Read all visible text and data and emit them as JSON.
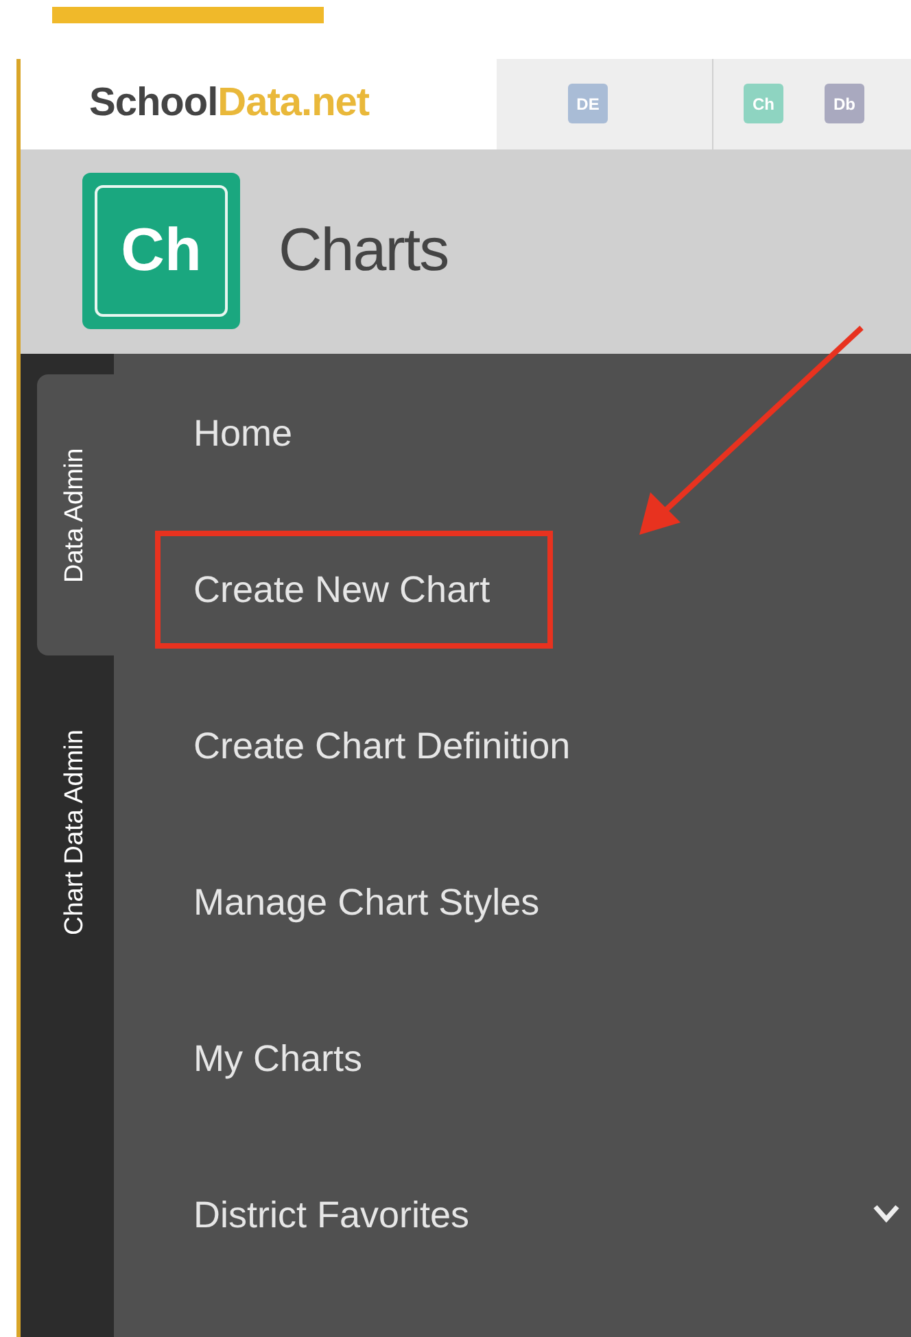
{
  "logo": {
    "brand_dark": "School",
    "brand_accent": "Data.net"
  },
  "app_tiles": [
    {
      "label": "DE",
      "color": "#a9bcd6"
    },
    {
      "label": "Ch",
      "color": "#8ed4c1"
    },
    {
      "label": "Db",
      "color": "#a9a9bf"
    }
  ],
  "app_header": {
    "icon_label": "Ch",
    "title": "Charts"
  },
  "side_tabs": [
    {
      "label": "Data Admin",
      "selected": true
    },
    {
      "label": "Chart Data Admin",
      "selected": false
    }
  ],
  "menu": [
    {
      "label": "Home",
      "highlighted": false,
      "expandable": false
    },
    {
      "label": "Create New Chart",
      "highlighted": true,
      "expandable": false
    },
    {
      "label": "Create Chart Definition",
      "highlighted": false,
      "expandable": false
    },
    {
      "label": "Manage Chart Styles",
      "highlighted": false,
      "expandable": false
    },
    {
      "label": "My Charts",
      "highlighted": false,
      "expandable": false
    },
    {
      "label": "District Favorites",
      "highlighted": false,
      "expandable": true
    }
  ]
}
